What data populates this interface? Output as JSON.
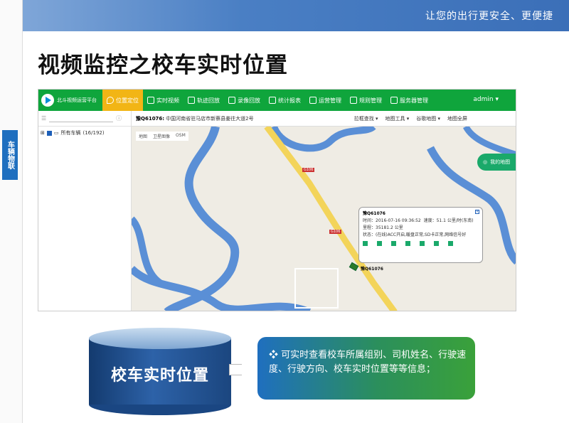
{
  "header": {
    "slogan": "让您的出行更安全、更便捷"
  },
  "side_tab": {
    "label": "车辆物联"
  },
  "slide_title": "视频监控之校车实时位置",
  "app": {
    "logo_text": "北斗视频运营平台",
    "nav_items": [
      {
        "label": "位置定位",
        "icon": "location-pin-icon",
        "active": true
      },
      {
        "label": "实时视频",
        "icon": "video-icon",
        "active": false
      },
      {
        "label": "轨迹回放",
        "icon": "track-icon",
        "active": false
      },
      {
        "label": "录像回放",
        "icon": "playback-icon",
        "active": false
      },
      {
        "label": "统计报表",
        "icon": "chart-icon",
        "active": false
      },
      {
        "label": "运营管理",
        "icon": "manage-icon",
        "active": false
      },
      {
        "label": "规则管理",
        "icon": "rules-icon",
        "active": false
      },
      {
        "label": "服务器管理",
        "icon": "server-icon",
        "active": false
      }
    ],
    "user": "admin",
    "left_panel": {
      "tree_item": "所有车辆",
      "tree_count": "(16/192)"
    },
    "address": {
      "plate": "豫Q61076:",
      "text": "中国河南省驻马店市新蔡县姜往大道2号"
    },
    "map_tools": [
      "拉框查找 ▾",
      "地图工具 ▾",
      "谷歌地图 ▾",
      "地图全屏"
    ],
    "map_tabs": [
      "地图",
      "卫星图像",
      "OSM"
    ],
    "my_location": "我的地图",
    "road_labels": [
      "G106",
      "G106"
    ],
    "popup": {
      "plate": "豫Q61076",
      "time_label": "时间：",
      "time": "2016-07-16 09:36:52",
      "speed_label": "速度：",
      "speed": "51.1 公里/时(东南)",
      "mileage_label": "里程：",
      "mileage": "35181.2 公里",
      "status_label": "状态：",
      "status": "(在线)ACC开启,暖盘正常,SD卡正常,网络信号好"
    },
    "car_label": "豫Q61076"
  },
  "diagram": {
    "cylinder_text": "校车实时位置",
    "info_text": "❖ 可实时查看校车所属组别、司机姓名、行驶速度、行驶方向、校车实时位置等等信息；"
  },
  "colors": {
    "nav_green": "#0fa53c",
    "active_tab": "#f2b515",
    "map_bg": "#efece4",
    "river": "#5a8fd6",
    "road": "#f3d45a"
  }
}
